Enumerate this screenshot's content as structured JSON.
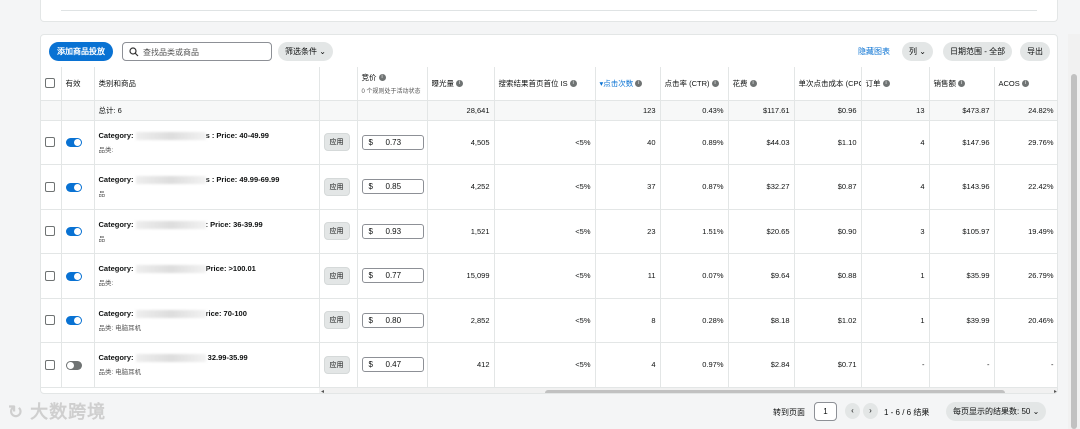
{
  "toolbar": {
    "add_button": "添加商品投放",
    "search_placeholder": "查找品类或商品",
    "filter": "筛选条件",
    "hide_chart": "隐藏图表",
    "columns": "列",
    "date_range": "日期范围 - 全部",
    "export": "导出"
  },
  "headers": {
    "enabled": "有效",
    "category": "类别和商品",
    "bid": "竞价",
    "bid_sub": "0 个规则处于活动状态",
    "impressions": "曝光量",
    "top_search_is": "搜索结果首页首位 IS",
    "clicks": "点击次数",
    "ctr": "点击率 (CTR)",
    "spend": "花费",
    "cpc": "单次点击成本 (CPC)",
    "orders": "订单",
    "sales": "销售额",
    "acos": "ACOS"
  },
  "total": {
    "label": "总计: 6",
    "impressions": "28,641",
    "clicks": "123",
    "ctr": "0.43%",
    "spend": "$117.61",
    "cpc": "$0.96",
    "orders": "13",
    "sales": "$473.87",
    "acos": "24.82%"
  },
  "rows": [
    {
      "enabled": true,
      "cat_prefix": "Category: ",
      "cat_suffix": "s : Price: 40-49.99",
      "sub": "品类: ",
      "apply": "应用",
      "currency": "$",
      "bid": "0.73",
      "impressions": "4,505",
      "is": "<5%",
      "clicks": "40",
      "ctr": "0.89%",
      "spend": "$44.03",
      "cpc": "$1.10",
      "orders": "4",
      "sales": "$147.96",
      "acos": "29.76%"
    },
    {
      "enabled": true,
      "cat_prefix": "Category: ",
      "cat_suffix": "s : Price: 49.99-69.99",
      "sub": "品",
      "apply": "应用",
      "currency": "$",
      "bid": "0.85",
      "impressions": "4,252",
      "is": "<5%",
      "clicks": "37",
      "ctr": "0.87%",
      "spend": "$32.27",
      "cpc": "$0.87",
      "orders": "4",
      "sales": "$143.96",
      "acos": "22.42%"
    },
    {
      "enabled": true,
      "cat_prefix": "Category: ",
      "cat_suffix": ": Price: 36-39.99",
      "sub": "品",
      "apply": "应用",
      "currency": "$",
      "bid": "0.93",
      "impressions": "1,521",
      "is": "<5%",
      "clicks": "23",
      "ctr": "1.51%",
      "spend": "$20.65",
      "cpc": "$0.90",
      "orders": "3",
      "sales": "$105.97",
      "acos": "19.49%"
    },
    {
      "enabled": true,
      "cat_prefix": "Category: ",
      "cat_suffix": "Price: >100.01",
      "sub": "品类: ",
      "apply": "应用",
      "currency": "$",
      "bid": "0.77",
      "impressions": "15,099",
      "is": "<5%",
      "clicks": "11",
      "ctr": "0.07%",
      "spend": "$9.64",
      "cpc": "$0.88",
      "orders": "1",
      "sales": "$35.99",
      "acos": "26.79%"
    },
    {
      "enabled": true,
      "cat_prefix": "Category: ",
      "cat_suffix": "rice: 70-100",
      "sub": "品类: 电脑耳机",
      "apply": "应用",
      "currency": "$",
      "bid": "0.80",
      "impressions": "2,852",
      "is": "<5%",
      "clicks": "8",
      "ctr": "0.28%",
      "spend": "$8.18",
      "cpc": "$1.02",
      "orders": "1",
      "sales": "$39.99",
      "acos": "20.46%"
    },
    {
      "enabled": false,
      "cat_prefix": "Category: ",
      "cat_suffix": " 32.99-35.99",
      "sub": "品类: 电脑耳机",
      "apply": "应用",
      "currency": "$",
      "bid": "0.47",
      "impressions": "412",
      "is": "<5%",
      "clicks": "4",
      "ctr": "0.97%",
      "spend": "$2.84",
      "cpc": "$0.71",
      "orders": "-",
      "sales": "-",
      "acos": "-"
    }
  ],
  "footer": {
    "goto_label": "转到页面",
    "page": "1",
    "range": "1 - 6 / 6 结果",
    "per_page": "每页显示的结果数: 50",
    "watermark": "大数跨境"
  },
  "colors": {
    "accent": "#0972d3",
    "pill": "#e3e6e6"
  }
}
